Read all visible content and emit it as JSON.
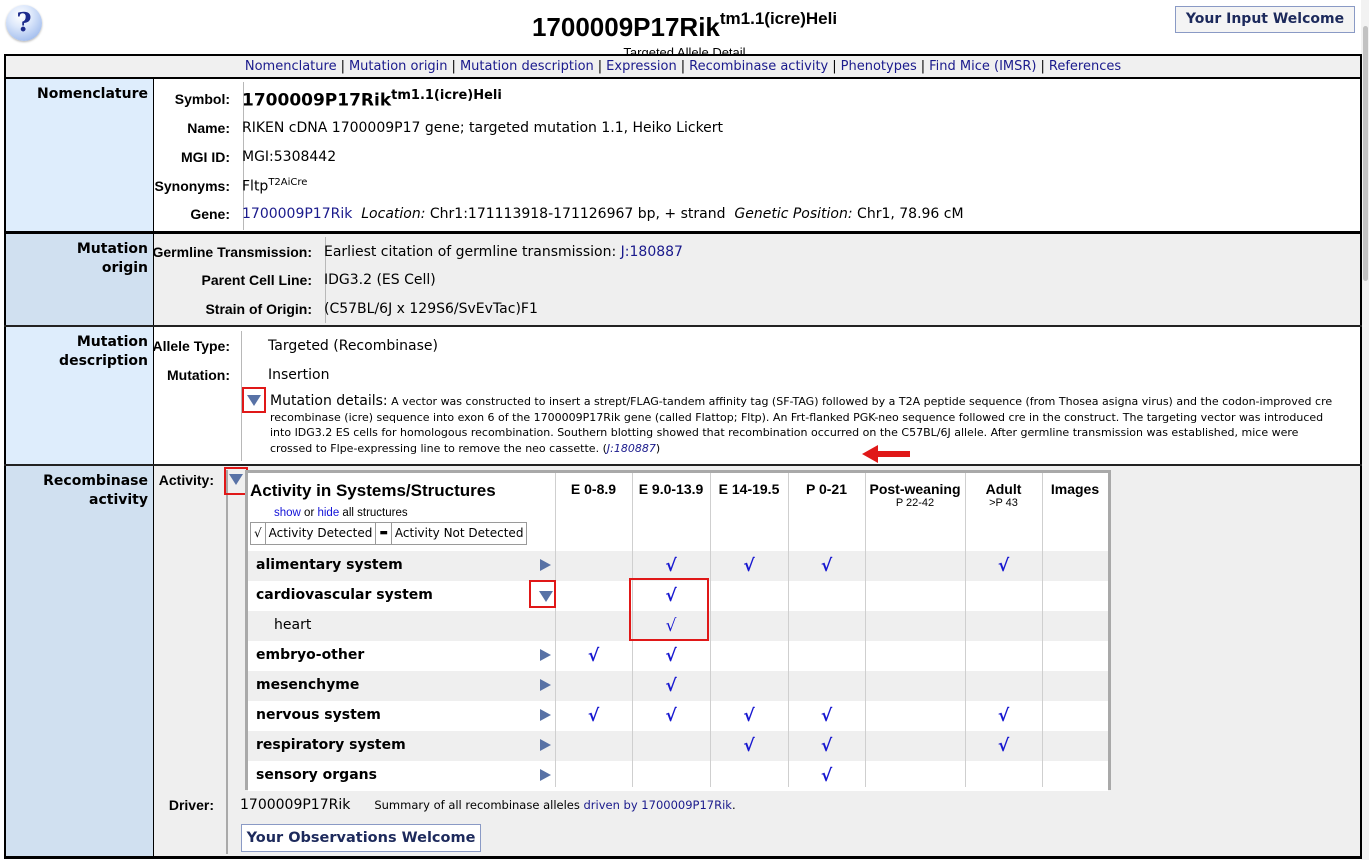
{
  "header": {
    "help_icon": "question-mark-icon",
    "help_glyph": "?",
    "title_main": "1700009P17Rik",
    "title_sup": "tm1.1(icre)Heli",
    "subtitle": "Targeted Allele Detail",
    "input_button": "Your Input Welcome"
  },
  "nav": {
    "links": [
      "Nomenclature",
      "Mutation origin",
      "Mutation description",
      "Expression",
      "Recombinase activity",
      "Phenotypes",
      "Find Mice (IMSR)",
      "References"
    ],
    "separator": "|"
  },
  "nomenclature": {
    "section_label": "Nomenclature",
    "symbol_label": "Symbol:",
    "symbol_main": "1700009P17Rik",
    "symbol_sup": "tm1.1(icre)Heli",
    "name_label": "Name:",
    "name_value": "RIKEN cDNA 1700009P17 gene; targeted mutation 1.1, Heiko Lickert",
    "mgi_label": "MGI ID:",
    "mgi_value": "MGI:5308442",
    "synonyms_label": "Synonyms:",
    "synonym_main": "Fltp",
    "synonym_sup": "T2AiCre",
    "gene_label": "Gene:",
    "gene_link": "1700009P17Rik",
    "location_label": "Location:",
    "location_value": "Chr1:171113918-171126967 bp, + strand",
    "genetic_pos_label": "Genetic Position:",
    "genetic_pos_value": "Chr1, 78.96 cM"
  },
  "mutation_origin": {
    "section_label_1": "Mutation",
    "section_label_2": "origin",
    "germline_label": "Germline Transmission:",
    "germline_text": "Earliest citation of germline transmission:",
    "germline_link": "J:180887",
    "parent_label": "Parent Cell Line:",
    "parent_value": "IDG3.2 (ES Cell)",
    "strain_label": "Strain of Origin:",
    "strain_value": "(C57BL/6J x 129S6/SvEvTac)F1"
  },
  "mutation_description": {
    "section_label_1": "Mutation",
    "section_label_2": "description",
    "allele_type_label": "Allele Type:",
    "allele_type_value": "Targeted (Recombinase)",
    "mutation_label": "Mutation:",
    "mutation_value": "Insertion",
    "details_label": "Mutation details:",
    "details_text": "A vector was constructed to insert a strept/FLAG-tandem affinity tag (SF-TAG) followed by a T2A peptide sequence (from Thosea asigna virus) and the codon-improved cre recombinase (icre) sequence into exon 6 of the 1700009P17Rik gene (called Flattop; Fltp). An Frt-flanked PGK-neo sequence followed cre in the construct. The targeting vector was introduced into IDG3.2 ES cells for homologous recombination. Southern blotting showed that recombination occurred on the C57BL/6J allele. After germline transmission was established, mice were crossed to Flpe-expressing line to remove the neo cassette.",
    "details_ref_open": " (",
    "details_ref": "J:180887",
    "details_ref_close": ")"
  },
  "recombinase": {
    "section_label_1": "Recombinase",
    "section_label_2": "activity",
    "activity_label": "Activity:",
    "table_title": "Activity in Systems/Structures",
    "show_link": "show",
    "or_text": " or ",
    "hide_link": "hide",
    "all_structures_text": " all structures",
    "legend": {
      "detected_symbol": "√",
      "detected_label": "Activity Detected",
      "not_detected_symbol": "▬",
      "not_detected_label": "Activity Not Detected"
    },
    "columns": [
      {
        "label": "E 0-8.9",
        "sub": ""
      },
      {
        "label": "E 9.0-13.9",
        "sub": ""
      },
      {
        "label": "E 14-19.5",
        "sub": ""
      },
      {
        "label": "P 0-21",
        "sub": ""
      },
      {
        "label": "Post-weaning",
        "sub": "P 22-42"
      },
      {
        "label": "Adult",
        "sub": ">P 43"
      },
      {
        "label": "Images",
        "sub": ""
      }
    ],
    "check_glyph": "√",
    "rows": [
      {
        "label": "alimentary system",
        "child": false,
        "toggle": "collapsed",
        "cells": [
          false,
          true,
          true,
          true,
          false,
          true,
          false
        ]
      },
      {
        "label": "cardiovascular system",
        "child": false,
        "toggle": "expanded",
        "cells": [
          false,
          true,
          false,
          false,
          false,
          false,
          false
        ]
      },
      {
        "label": "heart",
        "child": true,
        "toggle": "none",
        "cells": [
          false,
          true,
          false,
          false,
          false,
          false,
          false
        ]
      },
      {
        "label": "embryo-other",
        "child": false,
        "toggle": "collapsed",
        "cells": [
          true,
          true,
          false,
          false,
          false,
          false,
          false
        ]
      },
      {
        "label": "mesenchyme",
        "child": false,
        "toggle": "collapsed",
        "cells": [
          false,
          true,
          false,
          false,
          false,
          false,
          false
        ]
      },
      {
        "label": "nervous system",
        "child": false,
        "toggle": "collapsed",
        "cells": [
          true,
          true,
          true,
          true,
          false,
          true,
          false
        ]
      },
      {
        "label": "respiratory system",
        "child": false,
        "toggle": "collapsed",
        "cells": [
          false,
          false,
          true,
          true,
          false,
          true,
          false
        ]
      },
      {
        "label": "sensory organs",
        "child": false,
        "toggle": "collapsed",
        "cells": [
          false,
          false,
          false,
          true,
          false,
          false,
          false
        ]
      }
    ],
    "driver_label": "Driver:",
    "driver_value": "1700009P17Rik",
    "driver_summary_text": "Summary of all recombinase alleles ",
    "driver_summary_link": "driven by 1700009P17Rik",
    "driver_summary_end": ".",
    "observations_button": "Your Observations Welcome"
  },
  "colors": {
    "link": "#1a1a8c",
    "label_bg_light": "#deedfc",
    "label_bg_dark": "#d0e0f0",
    "check": "#1818d0",
    "toggle": "#5872a6",
    "annotation_red": "#e01818"
  }
}
